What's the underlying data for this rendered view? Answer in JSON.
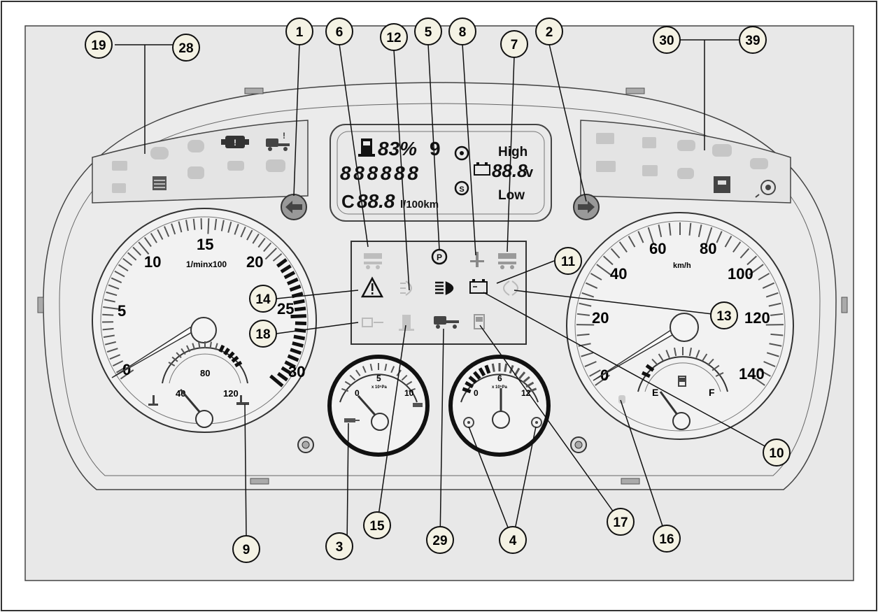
{
  "callouts": [
    {
      "id": "1",
      "label": "1"
    },
    {
      "id": "2",
      "label": "2"
    },
    {
      "id": "3",
      "label": "3"
    },
    {
      "id": "4",
      "label": "4"
    },
    {
      "id": "5",
      "label": "5"
    },
    {
      "id": "6",
      "label": "6"
    },
    {
      "id": "7",
      "label": "7"
    },
    {
      "id": "8",
      "label": "8"
    },
    {
      "id": "9",
      "label": "9"
    },
    {
      "id": "10",
      "label": "10"
    },
    {
      "id": "11",
      "label": "11"
    },
    {
      "id": "12",
      "label": "12"
    },
    {
      "id": "13",
      "label": "13"
    },
    {
      "id": "14",
      "label": "14"
    },
    {
      "id": "15",
      "label": "15"
    },
    {
      "id": "16",
      "label": "16"
    },
    {
      "id": "17",
      "label": "17"
    },
    {
      "id": "18",
      "label": "18"
    },
    {
      "id": "19",
      "label": "19"
    },
    {
      "id": "28",
      "label": "28"
    },
    {
      "id": "29",
      "label": "29"
    },
    {
      "id": "30",
      "label": "30"
    },
    {
      "id": "39",
      "label": "39"
    }
  ],
  "tachometer": {
    "ticks": [
      "0",
      "5",
      "10",
      "15",
      "20",
      "25",
      "30"
    ],
    "unit": "1/minx100"
  },
  "coolant_gauge": {
    "ticks": [
      "40",
      "80",
      "120"
    ]
  },
  "speedometer": {
    "ticks": [
      "0",
      "20",
      "40",
      "60",
      "80",
      "100",
      "120",
      "140"
    ],
    "unit": "km/h"
  },
  "fuel_gauge": {
    "ticks": [
      "E",
      "F"
    ]
  },
  "oil_gauge": {
    "ticks": [
      "0",
      "5",
      "10"
    ],
    "unit": "x 10⁵Pa"
  },
  "air_gauge": {
    "ticks": [
      "0",
      "6",
      "12"
    ],
    "unit": "x 10⁵Pa"
  },
  "lcd": {
    "fuel_pct": "83%",
    "gear": "9",
    "odometer": "888888",
    "consumption_prefix": "C",
    "consumption": "88.8",
    "consumption_unit": "l/100km",
    "high_label": "High",
    "low_label": "Low",
    "voltage": "88.8",
    "voltage_unit": "v"
  },
  "colors": {
    "panel": "#e6e6e6",
    "outline": "#555555",
    "callout_fill": "#f4f2e4",
    "dark": "#111111",
    "faded": "#bdbdbd"
  }
}
